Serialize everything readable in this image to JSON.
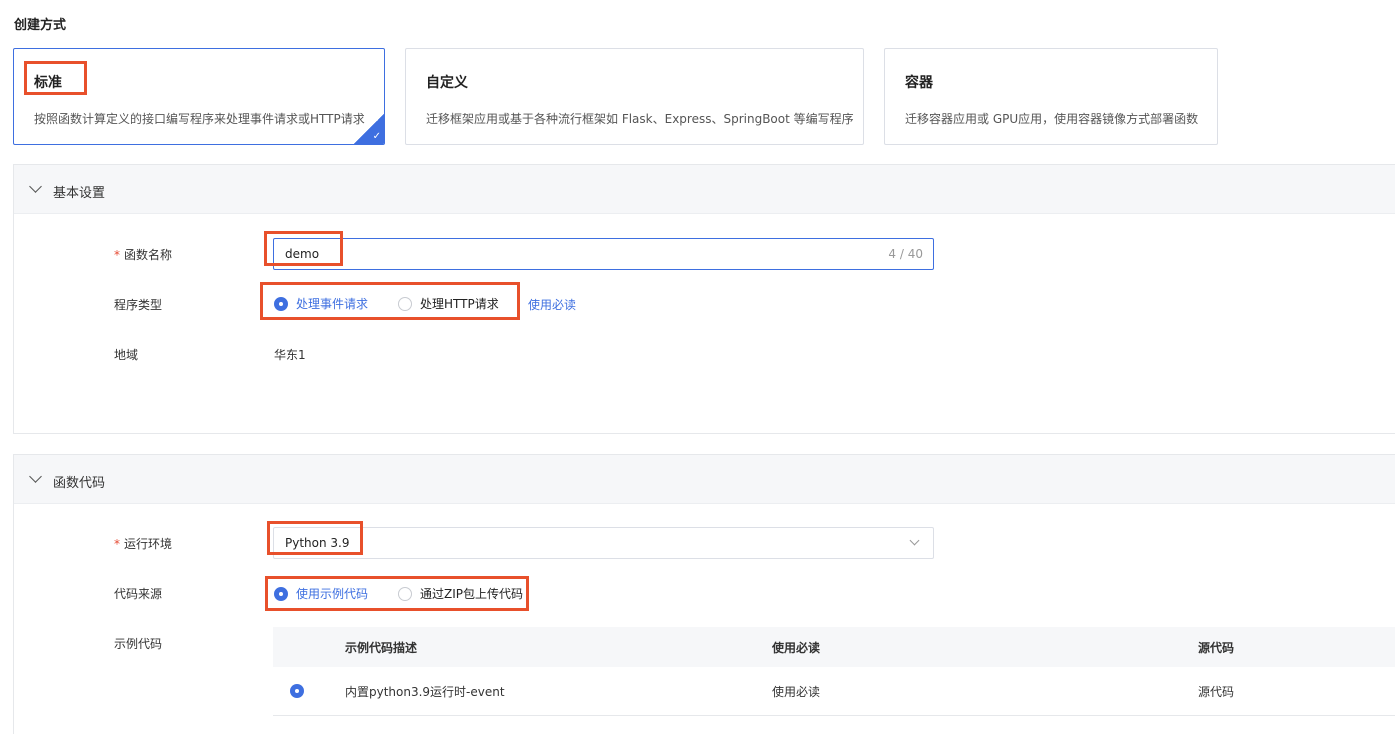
{
  "heading": "创建方式",
  "cards": [
    {
      "title": "标准",
      "desc": "按照函数计算定义的接口编写程序来处理事件请求或HTTP请求",
      "selected": true
    },
    {
      "title": "自定义",
      "desc": "迁移框架应用或基于各种流行框架如 Flask、Express、SpringBoot 等编写程序"
    },
    {
      "title": "容器",
      "desc": "迁移容器应用或 GPU应用，使用容器镜像方式部署函数"
    }
  ],
  "basic": {
    "title": "基本设置",
    "name_label": "函数名称",
    "name_value": "demo",
    "name_count": "4 / 40",
    "type_label": "程序类型",
    "type_options": [
      "处理事件请求",
      "处理HTTP请求"
    ],
    "type_selected": "处理事件请求",
    "type_link": "使用必读",
    "region_label": "地域",
    "region_value": "华东1"
  },
  "code": {
    "title": "函数代码",
    "runtime_label": "运行环境",
    "runtime_value": "Python 3.9",
    "source_label": "代码来源",
    "source_options": [
      "使用示例代码",
      "通过ZIP包上传代码"
    ],
    "source_selected": "使用示例代码",
    "sample_label": "示例代码",
    "table": {
      "headers": [
        "示例代码描述",
        "使用必读",
        "源代码"
      ],
      "rows": [
        {
          "desc": "内置python3.9运行时-event",
          "readme": "使用必读",
          "source": "源代码"
        }
      ]
    }
  },
  "colors": {
    "accent": "#3e6fe0",
    "highlight": "#e8502b",
    "required": "#e64a33"
  }
}
